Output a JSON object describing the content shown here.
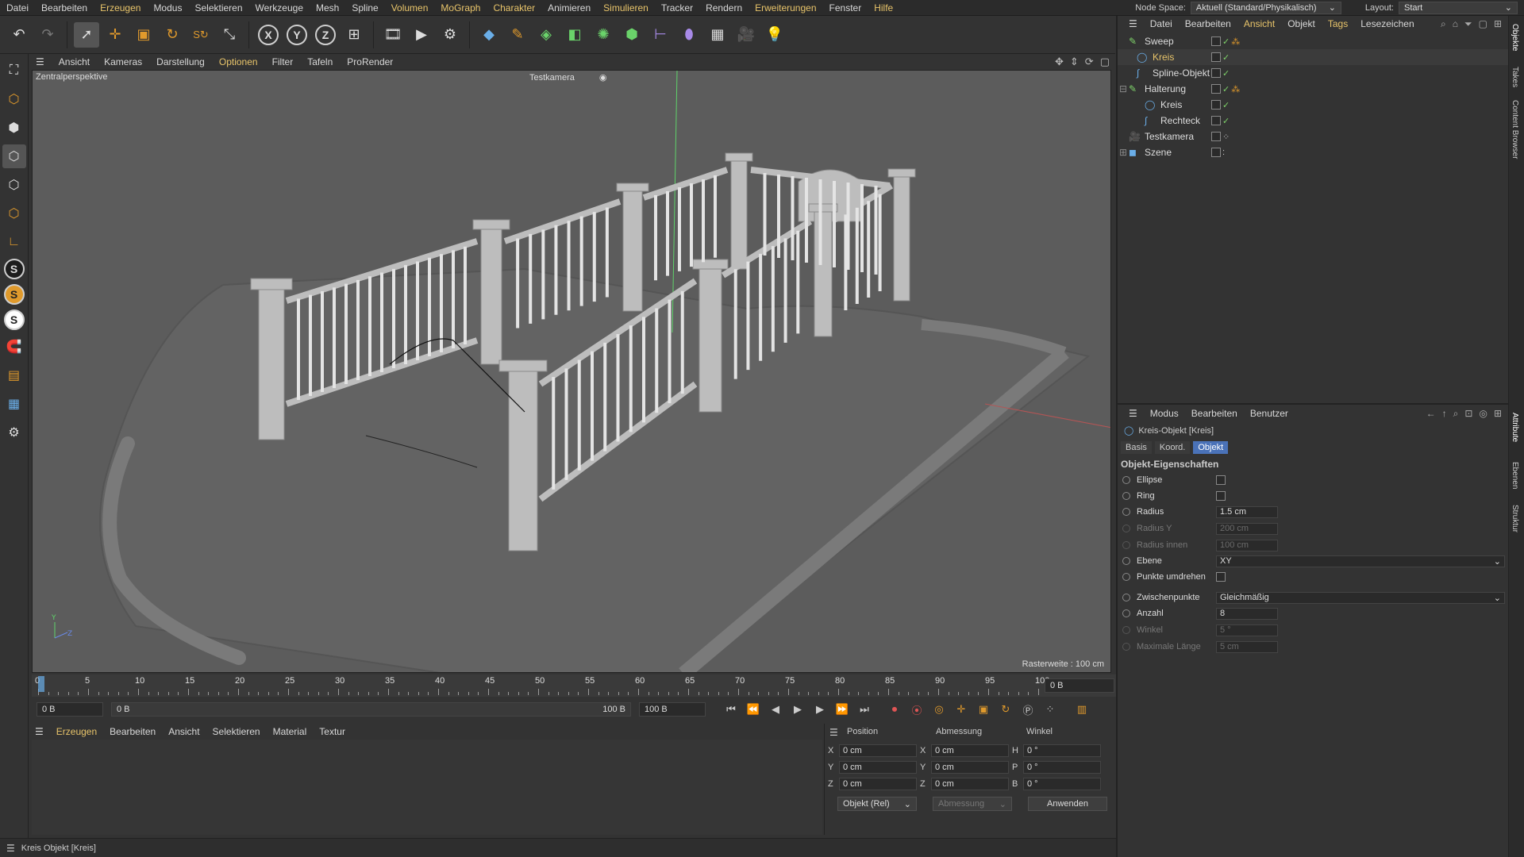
{
  "menu": [
    "Datei",
    "Bearbeiten",
    "Erzeugen",
    "Modus",
    "Selektieren",
    "Werkzeuge",
    "Mesh",
    "Spline",
    "Volumen",
    "MoGraph",
    "Charakter",
    "Animieren",
    "Simulieren",
    "Tracker",
    "Rendern",
    "Erweiterungen",
    "Fenster",
    "Hilfe"
  ],
  "node_space": {
    "label": "Node Space:",
    "value": "Aktuell (Standard/Physikalisch)"
  },
  "layout": {
    "label": "Layout:",
    "value": "Start"
  },
  "toolbar_axes": [
    "X",
    "Y",
    "Z"
  ],
  "viewport_menu": [
    "Ansicht",
    "Kameras",
    "Darstellung",
    "Optionen",
    "Filter",
    "Tafeln",
    "ProRender"
  ],
  "viewport": {
    "label": "Zentralperspektive",
    "camera": "Testkamera",
    "grid": "Rasterweite : 100 cm",
    "axis_y": "Y",
    "axis_z": "Z"
  },
  "timeline": {
    "ticks": [
      "0",
      "5",
      "10",
      "15",
      "20",
      "25",
      "30",
      "35",
      "40",
      "45",
      "50",
      "55",
      "60",
      "65",
      "70",
      "75",
      "80",
      "85",
      "90",
      "95",
      "100"
    ],
    "frame_field": "0 B",
    "current": "0 B",
    "range_start": "0 B",
    "range_mid": "0 B",
    "range_end": "100 B",
    "range_end2": "100 B"
  },
  "material_menu": [
    "Erzeugen",
    "Bearbeiten",
    "Ansicht",
    "Selektieren",
    "Material",
    "Textur"
  ],
  "coords": {
    "headers": [
      "Position",
      "Abmessung",
      "Winkel"
    ],
    "rows": [
      {
        "a": "X",
        "p": "0 cm",
        "b": "X",
        "s": "0 cm",
        "c": "H",
        "w": "0 °"
      },
      {
        "a": "Y",
        "p": "0 cm",
        "b": "Y",
        "s": "0 cm",
        "c": "P",
        "w": "0 °"
      },
      {
        "a": "Z",
        "p": "0 cm",
        "b": "Z",
        "s": "0 cm",
        "c": "B",
        "w": "0 °"
      }
    ],
    "mode": "Objekt (Rel)",
    "size_mode": "Abmessung",
    "apply": "Anwenden"
  },
  "status": "Kreis Objekt [Kreis]",
  "object_menu": [
    "Datei",
    "Bearbeiten",
    "Ansicht",
    "Objekt",
    "Tags",
    "Lesezeichen"
  ],
  "objects": [
    {
      "name": "Sweep",
      "indent": 0
    },
    {
      "name": "Kreis",
      "indent": 1
    },
    {
      "name": "Spline-Objekt",
      "indent": 1
    },
    {
      "name": "Halterung",
      "indent": 0
    },
    {
      "name": "Kreis",
      "indent": 1
    },
    {
      "name": "Rechteck",
      "indent": 1
    },
    {
      "name": "Testkamera",
      "indent": 0
    },
    {
      "name": "Szene",
      "indent": 0
    }
  ],
  "side_tabs": [
    "Objekte",
    "Takes",
    "Content Browser",
    "Attribute",
    "Ebenen",
    "Struktur"
  ],
  "attr_menu": [
    "Modus",
    "Bearbeiten",
    "Benutzer"
  ],
  "attr_title": "Kreis-Objekt [Kreis]",
  "attr_tabs": [
    "Basis",
    "Koord.",
    "Objekt"
  ],
  "attr_section": "Objekt-Eigenschaften",
  "attrs": {
    "ellipse": "Ellipse",
    "ring": "Ring",
    "radius": {
      "label": "Radius",
      "value": "1.5 cm"
    },
    "radius_y": {
      "label": "Radius Y",
      "value": "200 cm"
    },
    "radius_inner": {
      "label": "Radius innen",
      "value": "100 cm"
    },
    "ebene": {
      "label": "Ebene",
      "value": "XY"
    },
    "punkte": "Punkte umdrehen",
    "zwischen": {
      "label": "Zwischenpunkte",
      "value": "Gleichmäßig"
    },
    "anzahl": {
      "label": "Anzahl",
      "value": "8"
    },
    "winkel": {
      "label": "Winkel",
      "value": "5 °"
    },
    "maxlen": {
      "label": "Maximale Länge",
      "value": "5 cm"
    }
  }
}
